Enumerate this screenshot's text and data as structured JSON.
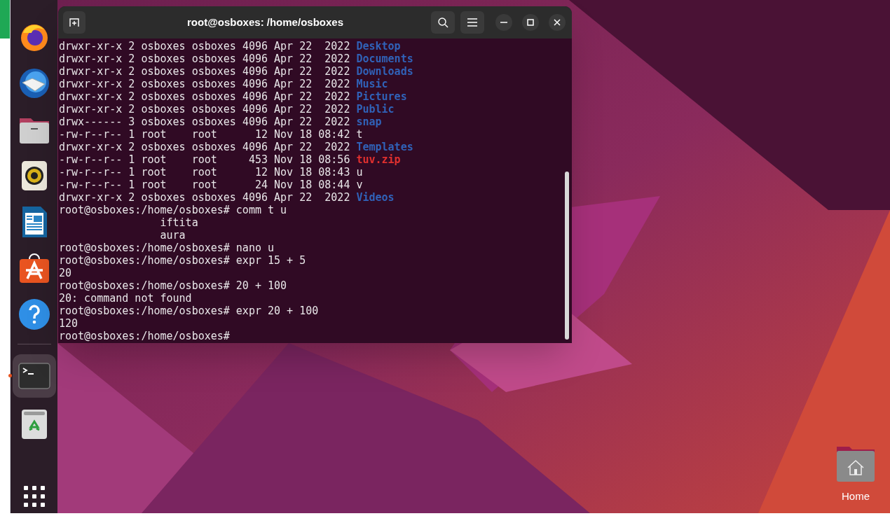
{
  "dock": [
    {
      "kind": "browser",
      "running": false,
      "selected": false
    },
    {
      "kind": "mail",
      "running": false,
      "selected": false
    },
    {
      "kind": "files",
      "running": false,
      "selected": false
    },
    {
      "kind": "music",
      "running": false,
      "selected": false
    },
    {
      "kind": "writer",
      "running": false,
      "selected": false
    },
    {
      "kind": "store",
      "running": false,
      "selected": false
    },
    {
      "kind": "help",
      "running": false,
      "selected": false
    },
    {
      "kind": "terminal",
      "running": true,
      "selected": true
    },
    {
      "kind": "trash",
      "running": false,
      "selected": false
    }
  ],
  "terminal": {
    "title": "root@osboxes: /home/osboxes",
    "lines": [
      {
        "kind": "dir",
        "meta": "drwxr-xr-x 2 osboxes osboxes 4096 Apr 22  2022",
        "name": "Desktop"
      },
      {
        "kind": "dir",
        "meta": "drwxr-xr-x 2 osboxes osboxes 4096 Apr 22  2022",
        "name": "Documents"
      },
      {
        "kind": "dir",
        "meta": "drwxr-xr-x 2 osboxes osboxes 4096 Apr 22  2022",
        "name": "Downloads"
      },
      {
        "kind": "dir",
        "meta": "drwxr-xr-x 2 osboxes osboxes 4096 Apr 22  2022",
        "name": "Music"
      },
      {
        "kind": "dir",
        "meta": "drwxr-xr-x 2 osboxes osboxes 4096 Apr 22  2022",
        "name": "Pictures"
      },
      {
        "kind": "dir",
        "meta": "drwxr-xr-x 2 osboxes osboxes 4096 Apr 22  2022",
        "name": "Public"
      },
      {
        "kind": "dir",
        "meta": "drwx------ 3 osboxes osboxes 4096 Apr 22  2022",
        "name": "snap"
      },
      {
        "kind": "file",
        "meta": "-rw-r--r-- 1 root    root      12 Nov 18 08:42",
        "name": "t"
      },
      {
        "kind": "dir",
        "meta": "drwxr-xr-x 2 osboxes osboxes 4096 Apr 22  2022",
        "name": "Templates"
      },
      {
        "kind": "archive",
        "meta": "-rw-r--r-- 1 root    root     453 Nov 18 08:56",
        "name": "tuv.zip"
      },
      {
        "kind": "file",
        "meta": "-rw-r--r-- 1 root    root      12 Nov 18 08:43",
        "name": "u"
      },
      {
        "kind": "file",
        "meta": "-rw-r--r-- 1 root    root      24 Nov 18 08:44",
        "name": "v"
      },
      {
        "kind": "dir",
        "meta": "drwxr-xr-x 2 osboxes osboxes 4096 Apr 22  2022",
        "name": "Videos"
      },
      {
        "kind": "command",
        "prompt": "root@osboxes:/home/osboxes#",
        "text": "comm t u"
      },
      {
        "kind": "output",
        "text": "                iftita"
      },
      {
        "kind": "output",
        "text": "                aura"
      },
      {
        "kind": "command",
        "prompt": "root@osboxes:/home/osboxes#",
        "text": "nano u"
      },
      {
        "kind": "command",
        "prompt": "root@osboxes:/home/osboxes#",
        "text": "expr 15 + 5"
      },
      {
        "kind": "output",
        "text": "20"
      },
      {
        "kind": "command",
        "prompt": "root@osboxes:/home/osboxes#",
        "text": "20 + 100"
      },
      {
        "kind": "output",
        "text": "20: command not found"
      },
      {
        "kind": "command",
        "prompt": "root@osboxes:/home/osboxes#",
        "text": "expr 20 + 100"
      },
      {
        "kind": "output",
        "text": "120"
      },
      {
        "kind": "prompt",
        "prompt": "root@osboxes:/home/osboxes#"
      }
    ]
  },
  "desktop_icons": [
    {
      "label": "Home"
    }
  ]
}
